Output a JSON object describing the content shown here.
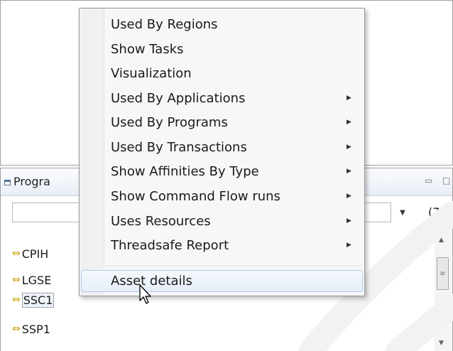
{
  "programs_view": {
    "title": "Progra",
    "minimize_icon": "minimize-icon",
    "maximize_icon": "maximize-icon",
    "filter_value": "",
    "count_label": "(7",
    "items": [
      {
        "label": "CPIH",
        "icon": "program-arrow-icon",
        "selected": false
      },
      {
        "label": "LGSE",
        "icon": "program-arrow-icon",
        "selected": false
      },
      {
        "label": "SSC1",
        "icon": "program-arrow-icon",
        "selected": true
      },
      {
        "label": "SSP1",
        "icon": "program-arrow-icon",
        "selected": false
      }
    ]
  },
  "context_menu": {
    "items": [
      {
        "label": "Used By Regions",
        "submenu": false
      },
      {
        "label": "Show Tasks",
        "submenu": false
      },
      {
        "label": "Visualization",
        "submenu": false
      },
      {
        "label": "Used By Applications",
        "submenu": true
      },
      {
        "label": "Used By Programs",
        "submenu": true
      },
      {
        "label": "Used By Transactions",
        "submenu": true
      },
      {
        "label": "Show Affinities By Type",
        "submenu": true
      },
      {
        "label": "Show Command Flow runs",
        "submenu": true
      },
      {
        "label": "Uses Resources",
        "submenu": true
      },
      {
        "label": "Threadsafe Report",
        "submenu": true
      },
      {
        "label": "Asset details",
        "submenu": false,
        "highlighted": true
      }
    ]
  },
  "colors": {
    "menu_highlight": "#e6eef9",
    "menu_highlight_border": "#aecbee",
    "program_icon": "#c8a000",
    "panel_border": "#a0a0a0"
  }
}
